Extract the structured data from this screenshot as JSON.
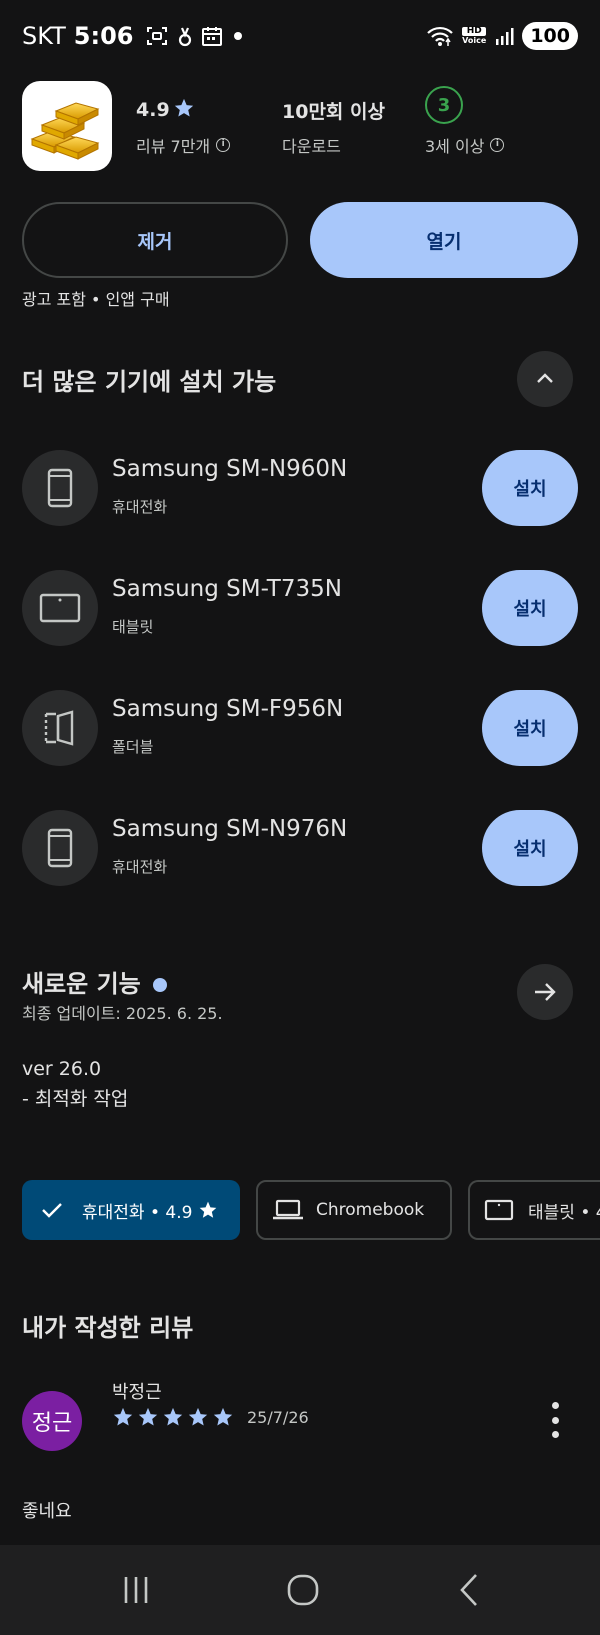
{
  "status_bar": {
    "carrier": "SKT",
    "time": "5:06",
    "hd_voice_top": "HD",
    "hd_voice_bottom": "Voice",
    "battery": "100",
    "icons": [
      "screenshot-icon",
      "location-icon",
      "calendar-icon",
      "notification-dot-icon",
      "wifi-icon",
      "hd-voice-icon",
      "signal-icon",
      "battery-icon"
    ]
  },
  "app": {
    "icon": "gold-bars-icon",
    "rating": "4.9",
    "reviews_label": "리뷰 7만개",
    "downloads": "10만회 이상",
    "downloads_label": "다운로드",
    "age_rating": "3",
    "age_label": "3세 이상"
  },
  "actions": {
    "remove": "제거",
    "open": "열기"
  },
  "ad_note": "광고 포함 • 인앱 구매",
  "devices_section": {
    "title": "더 많은 기기에 설치 가능",
    "install_label": "설치",
    "devices": [
      {
        "name": "Samsung SM-N960N",
        "type": "휴대전화",
        "icon": "phone-icon"
      },
      {
        "name": "Samsung SM-T735N",
        "type": "태블릿",
        "icon": "tablet-icon"
      },
      {
        "name": "Samsung SM-F956N",
        "type": "폴더블",
        "icon": "foldable-icon"
      },
      {
        "name": "Samsung SM-N976N",
        "type": "휴대전화",
        "icon": "phone-icon"
      }
    ]
  },
  "whats_new": {
    "title": "새로운 기능",
    "updated": "최종 업데이트: 2025. 6. 25.",
    "version": "ver 26.0",
    "note": "- 최적화 작업"
  },
  "device_chips": [
    {
      "label": "휴대전화 • 4.9",
      "selected": true
    },
    {
      "label": "Chromebook",
      "selected": false
    },
    {
      "label": "태블릿 • 4",
      "selected": false
    }
  ],
  "my_review": {
    "title": "내가 작성한 리뷰",
    "avatar_text": "정근",
    "reviewer": "박정근",
    "stars": 5,
    "date": "25/7/26",
    "text": "좋네요"
  },
  "colors": {
    "background": "#131314",
    "accent": "#a8c7fa",
    "accent_text": "#062e6f",
    "chip_selected": "#004a77",
    "age_badge": "#3aa34e",
    "avatar": "#7b1fa2"
  }
}
